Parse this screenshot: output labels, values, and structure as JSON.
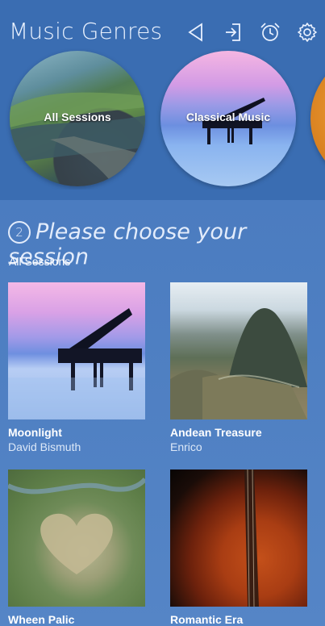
{
  "header": {
    "title": "Music Genres",
    "icons": [
      "back-icon",
      "exit-icon",
      "alarm-icon",
      "settings-icon"
    ]
  },
  "genres": [
    {
      "label": "All Sessions"
    },
    {
      "label": "Classical Music"
    },
    {
      "label": ""
    }
  ],
  "section": {
    "step_number": "2",
    "title": "Please choose your session",
    "subtitle": "All Sessions"
  },
  "sessions": [
    {
      "name": "Moonlight",
      "artist": "David Bismuth"
    },
    {
      "name": "Andean Treasure",
      "artist": "Enrico"
    },
    {
      "name": "Wheen Palic",
      "artist": ""
    },
    {
      "name": "Romantic Era",
      "artist": ""
    }
  ],
  "colors": {
    "background": "#4b7cc0",
    "header": "#3a6db2",
    "text": "#ffffff"
  }
}
